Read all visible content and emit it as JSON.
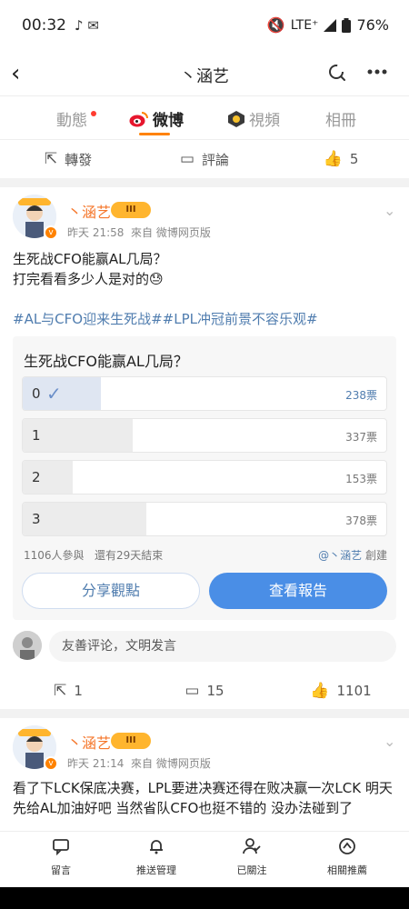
{
  "status_bar": {
    "time": "00:32",
    "network": "LTE⁺",
    "battery": "76%"
  },
  "header": {
    "title": "丶涵艺"
  },
  "tabs": [
    {
      "label": "動態"
    },
    {
      "label": "微博"
    },
    {
      "label": "視頻"
    },
    {
      "label": "相冊"
    }
  ],
  "top_actions": {
    "repost": "轉發",
    "comment": "評論",
    "like_count": "5"
  },
  "post1": {
    "username": "丶涵艺",
    "level_badge": "III",
    "time": "昨天 21:58",
    "source": "來自 微博网页版",
    "text_line1": "生死战CFO能赢AL几局？",
    "text_line2": "打完看看多少人是对的😓",
    "hashtags": "#AL与CFO迎来生死战##LPL冲冠前景不容乐观#",
    "poll": {
      "question": "生死战CFO能赢AL几局？",
      "options": [
        {
          "label": "0",
          "votes": 238,
          "count_text": "238票",
          "selected": true
        },
        {
          "label": "1",
          "votes": 337,
          "count_text": "337票",
          "selected": false
        },
        {
          "label": "2",
          "votes": 153,
          "count_text": "153票",
          "selected": false
        },
        {
          "label": "3",
          "votes": 378,
          "count_text": "378票",
          "selected": false
        }
      ],
      "participants": "1106人參與",
      "remaining": "還有29天結束",
      "creator": "@丶涵艺",
      "creator_suffix": "創建",
      "share_button": "分享觀點",
      "report_button": "查看報告"
    },
    "comment_placeholder": "友善评论，文明发言",
    "repost_count": "1",
    "comment_count": "15",
    "like_count": "1101"
  },
  "post2": {
    "username": "丶涵艺",
    "level_badge": "III",
    "time": "昨天 21:14",
    "source": "來自 微博网页版",
    "text": "看了下LCK保底决赛，LPL要进决赛还得在败决赢一次LCK 明天先给AL加油好吧 当然省队CFO也挺不错的 没办法碰到了"
  },
  "bottom_nav": [
    {
      "label": "留言",
      "icon": "message-icon"
    },
    {
      "label": "推送管理",
      "icon": "bell-icon"
    },
    {
      "label": "已關注",
      "icon": "user-check-icon"
    },
    {
      "label": "相關推薦",
      "icon": "compass-icon"
    }
  ],
  "colors": {
    "accent": "#ff8200",
    "link": "#507daf",
    "username": "#f5762a",
    "report_button": "#4a8ee6"
  }
}
